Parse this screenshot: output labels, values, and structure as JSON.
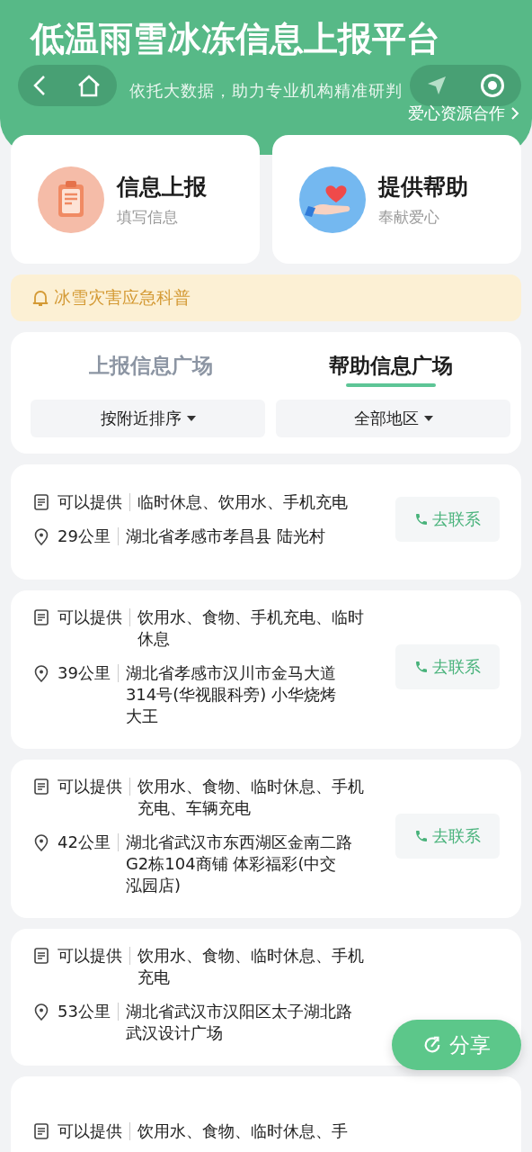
{
  "header": {
    "title": "低温雨雪冰冻信息上报平台",
    "subtitle": "依托大数据，助力专业机构精准研判",
    "partner_link": "爱心资源合作"
  },
  "actions": [
    {
      "kind": "report",
      "title": "信息上报",
      "subtitle": "填写信息"
    },
    {
      "kind": "help",
      "title": "提供帮助",
      "subtitle": "奉献爱心"
    }
  ],
  "notice": "冰雪灾害应急科普",
  "tabs": [
    {
      "label": "上报信息广场",
      "selected": false
    },
    {
      "label": "帮助信息广场",
      "selected": true
    }
  ],
  "filters": [
    "按附近排序",
    "全部地区"
  ],
  "listings": [
    {
      "supply_label": "可以提供",
      "supply": "临时休息、饮用水、手机充电",
      "distance": "29公里",
      "address": "湖北省孝感市孝昌县 陆光村",
      "contact": "去联系"
    },
    {
      "supply_label": "可以提供",
      "supply": "饮用水、食物、手机充电、临时休息",
      "distance": "39公里",
      "address": "湖北省孝感市汉川市金马大道314号(华视眼科旁) 小华烧烤大王",
      "contact": "去联系"
    },
    {
      "supply_label": "可以提供",
      "supply": "饮用水、食物、临时休息、手机充电、车辆充电",
      "distance": "42公里",
      "address": "湖北省武汉市东西湖区金南二路G2栋104商铺 体彩福彩(中交泓园店)",
      "contact": "去联系"
    },
    {
      "supply_label": "可以提供",
      "supply": "饮用水、食物、临时休息、手机充电",
      "distance": "53公里",
      "address": "湖北省武汉市汉阳区太子湖北路武汉设计广场"
    },
    {
      "supply_label": "可以提供",
      "supply": "饮用水、食物、临时休息、手"
    }
  ],
  "share_button": "分享"
}
